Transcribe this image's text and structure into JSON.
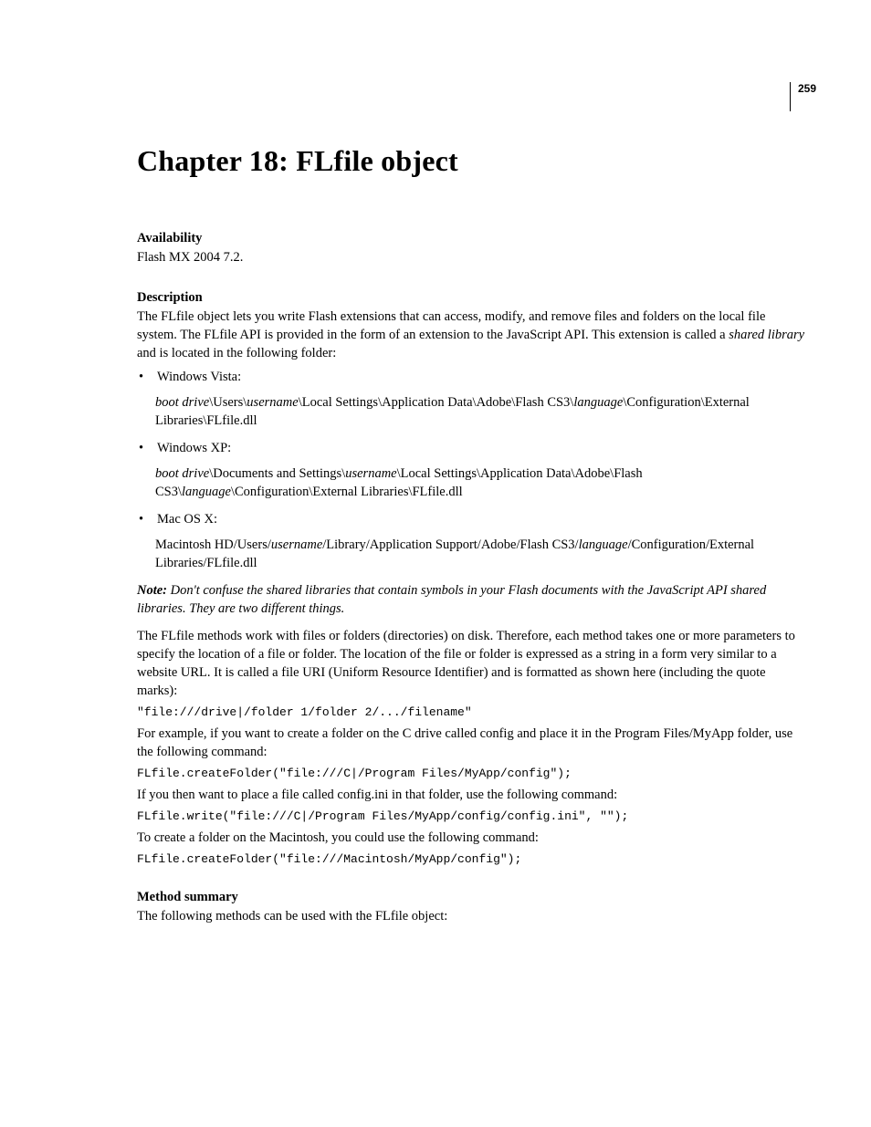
{
  "page_number": "259",
  "chapter_title": "Chapter 18: FLfile object",
  "availability": {
    "heading": "Availability",
    "text": "Flash MX 2004 7.2."
  },
  "description": {
    "heading": "Description",
    "intro_pre": "The FLfile object lets you write Flash extensions that can access, modify, and remove files and folders on the local file system. The FLfile API is provided in the form of an extension to the JavaScript API. This extension is called a ",
    "intro_em": "shared library",
    "intro_post": " and is located in the following folder:",
    "bullets": [
      {
        "label": "Windows Vista:",
        "seg": [
          {
            "t": "boot drive",
            "i": true
          },
          {
            "t": "\\Users\\"
          },
          {
            "t": "username",
            "i": true
          },
          {
            "t": "\\Local Settings\\Application Data\\Adobe\\Flash CS3\\"
          },
          {
            "t": "language",
            "i": true
          },
          {
            "t": "\\Configuration\\External Libraries\\FLfile.dll"
          }
        ]
      },
      {
        "label": "Windows XP:",
        "seg": [
          {
            "t": "boot drive",
            "i": true
          },
          {
            "t": "\\Documents and Settings\\"
          },
          {
            "t": "username",
            "i": true
          },
          {
            "t": "\\Local Settings\\Application Data\\Adobe\\Flash CS3\\"
          },
          {
            "t": "language",
            "i": true
          },
          {
            "t": "\\Configuration\\External Libraries\\FLfile.dll"
          }
        ]
      },
      {
        "label": "Mac OS X:",
        "seg": [
          {
            "t": "Macintosh HD/Users/"
          },
          {
            "t": "username",
            "i": true
          },
          {
            "t": "/Library/Application Support/Adobe/Flash CS3/"
          },
          {
            "t": "language",
            "i": true
          },
          {
            "t": "/Configuration/External Libraries/FLfile.dll"
          }
        ]
      }
    ],
    "note_label": "Note:",
    "note_text": " Don't confuse the shared libraries that contain symbols in your Flash documents with the JavaScript API shared libraries. They are two different things.",
    "methods_para": "The FLfile methods work with files or folders (directories) on disk. Therefore, each method takes one or more parameters to specify the location of a file or folder. The location of the file or folder is expressed as a string in a form very similar to a website URL. It is called a file URI (Uniform Resource Identifier) and is formatted as shown here (including the quote marks):",
    "code1": "\"file:///drive|/folder 1/folder 2/.../filename\"",
    "para_example1": "For example, if you want to create a folder on the C drive called config and place it in the Program Files/MyApp folder, use the following command:",
    "code2": "FLfile.createFolder(\"file:///C|/Program Files/MyApp/config\");",
    "para_example2": "If you then want to place a file called config.ini in that folder, use the following command:",
    "code3": "FLfile.write(\"file:///C|/Program Files/MyApp/config/config.ini\", \"\");",
    "para_example3": "To create a folder on the Macintosh, you could use the following command:",
    "code4": "FLfile.createFolder(\"file:///Macintosh/MyApp/config\");"
  },
  "method_summary": {
    "heading": "Method summary",
    "text": "The following methods can be used with the FLfile object:"
  }
}
